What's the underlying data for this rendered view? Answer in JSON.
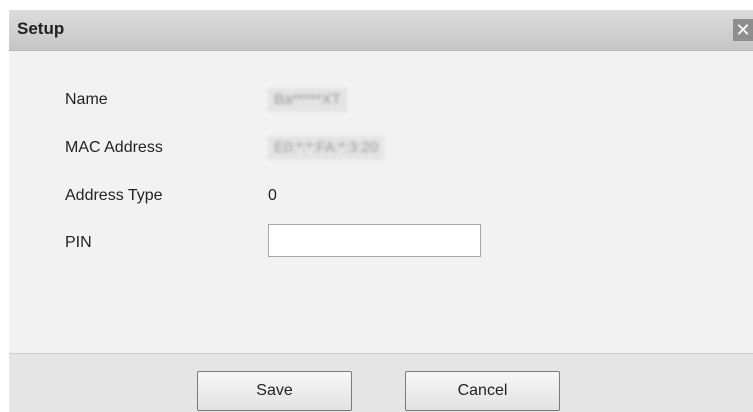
{
  "dialog": {
    "title": "Setup",
    "close_glyph": "✕",
    "fields": {
      "name": {
        "label": "Name",
        "value": "Ba*****XT"
      },
      "mac": {
        "label": "MAC Address",
        "value": "E0:*:*:FA:*:3:20"
      },
      "address_type": {
        "label": "Address Type",
        "value": "0"
      },
      "pin": {
        "label": "PIN",
        "value": "",
        "placeholder": ""
      }
    },
    "buttons": {
      "save": "Save",
      "cancel": "Cancel"
    }
  }
}
